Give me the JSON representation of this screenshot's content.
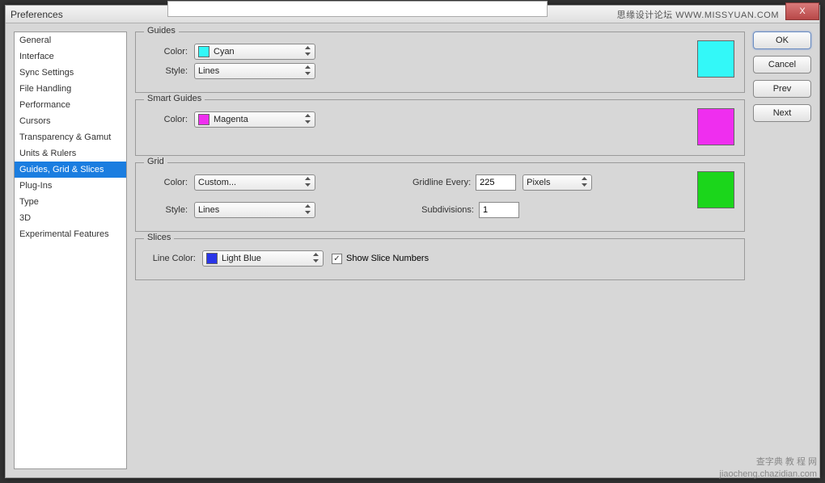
{
  "window": {
    "title": "Preferences",
    "close_x": "X"
  },
  "brand_top": "思缘设计论坛 WWW.MISSYUAN.COM",
  "brand_bottom1": "查字典 教 程 网",
  "brand_bottom2": "jiaocheng.chazidian.com",
  "sidebar": {
    "items": [
      "General",
      "Interface",
      "Sync Settings",
      "File Handling",
      "Performance",
      "Cursors",
      "Transparency & Gamut",
      "Units & Rulers",
      "Guides, Grid & Slices",
      "Plug-Ins",
      "Type",
      "3D",
      "Experimental Features"
    ],
    "selected_index": 8
  },
  "buttons": {
    "ok": "OK",
    "cancel": "Cancel",
    "prev": "Prev",
    "next": "Next"
  },
  "guides": {
    "legend": "Guides",
    "color_label": "Color:",
    "color_value": "Cyan",
    "color_swatch": "#33f8f8",
    "style_label": "Style:",
    "style_value": "Lines",
    "preview": "#33f8f8"
  },
  "smart_guides": {
    "legend": "Smart Guides",
    "color_label": "Color:",
    "color_value": "Magenta",
    "color_swatch": "#ef2eef",
    "preview": "#ef2eef"
  },
  "grid": {
    "legend": "Grid",
    "color_label": "Color:",
    "color_value": "Custom...",
    "style_label": "Style:",
    "style_value": "Lines",
    "gridline_label": "Gridline Every:",
    "gridline_value": "225",
    "gridline_unit": "Pixels",
    "subdiv_label": "Subdivisions:",
    "subdiv_value": "1",
    "preview": "#1bd61b"
  },
  "slices": {
    "legend": "Slices",
    "linecolor_label": "Line Color:",
    "linecolor_value": "Light Blue",
    "linecolor_swatch": "#2a36e8",
    "show_numbers_label": "Show Slice Numbers",
    "show_numbers_checked": "✓"
  }
}
